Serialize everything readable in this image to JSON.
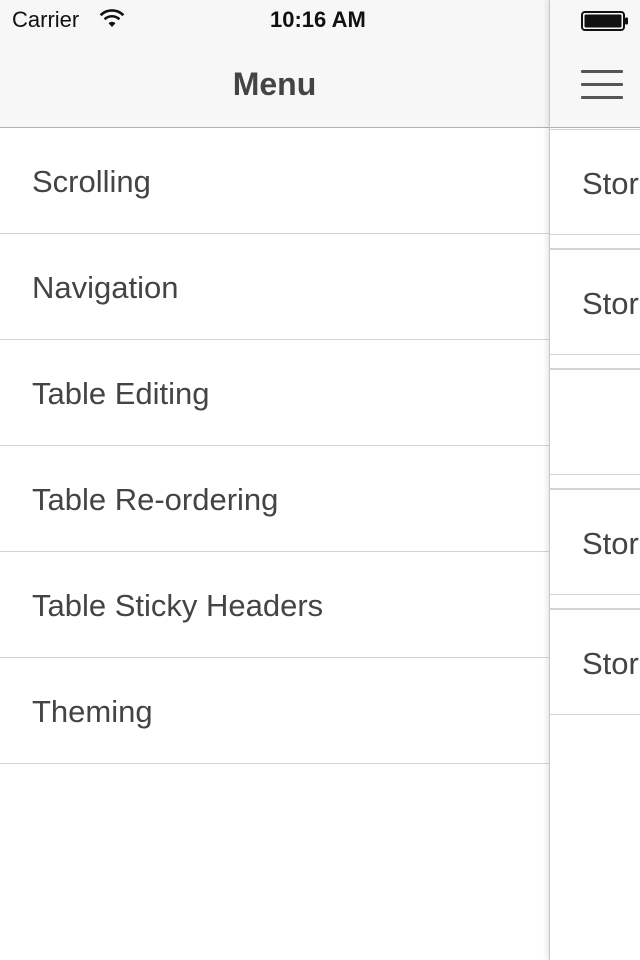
{
  "status_bar": {
    "carrier": "Carrier",
    "time": "10:16 AM",
    "wifi_icon": "wifi-icon",
    "battery_icon": "battery-full-icon"
  },
  "menu": {
    "title": "Menu",
    "items": [
      {
        "label": "Scrolling"
      },
      {
        "label": "Navigation"
      },
      {
        "label": "Table Editing"
      },
      {
        "label": "Table Re-ordering"
      },
      {
        "label": "Table Sticky Headers"
      },
      {
        "label": "Theming"
      }
    ]
  },
  "content": {
    "menu_button_icon": "hamburger-menu-icon",
    "rows": [
      {
        "label": "Stor"
      },
      {
        "label": "Stor"
      },
      {
        "label": ""
      },
      {
        "label": "Stor"
      },
      {
        "label": "Stor"
      }
    ]
  },
  "colors": {
    "bar_background": "#f7f7f7",
    "text": "#444444",
    "separator": "#d4d4d4"
  }
}
